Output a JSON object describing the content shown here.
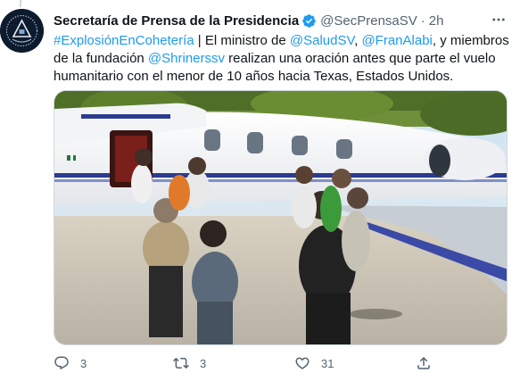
{
  "author": {
    "name": "Secretaría de Prensa de la Presidencia",
    "handle": "@SecPrensaSV",
    "separator": "·",
    "time": "2h"
  },
  "tweet_text": {
    "hashtag": "#ExplosiónEnCohetería",
    "t1": " | El ministro de ",
    "mention1": "@SaludSV",
    "t2": ", ",
    "mention2": "@FranAlabi",
    "t3": ", y miembros de la fundación ",
    "mention3": "@Shrinerssv",
    "t4": " realizan una oración antes que parte el vuelo humanitario con el menor de 10 años hacia Texas, Estados Unidos."
  },
  "actions": {
    "reply_count": "3",
    "retweet_count": "3",
    "like_count": "31"
  },
  "colors": {
    "link": "#1d9bf0",
    "muted": "#536471",
    "verified": "#1d9bf0"
  },
  "icons": [
    "verified-badge-icon",
    "more-icon",
    "reply-icon",
    "retweet-icon",
    "like-icon",
    "share-icon"
  ]
}
